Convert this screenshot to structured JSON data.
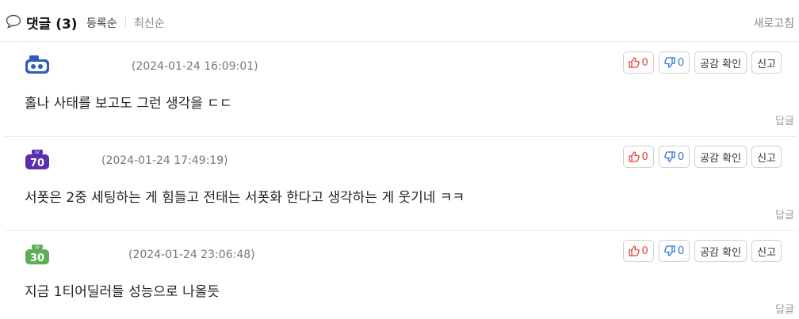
{
  "header": {
    "title": "댓글 (3)",
    "sort_registered": "등록순",
    "sort_latest": "최신순",
    "refresh": "새로고침"
  },
  "comments": [
    {
      "level": "",
      "level_color": "#2f5db8",
      "date": "(2024-01-24 16:09:01)",
      "text": "홀나 사태를 보고도 그런 생각을 ㄷㄷ",
      "likes": "0",
      "dislikes": "0",
      "empathy_label": "공감 확인",
      "report_label": "신고",
      "reply_label": "답글"
    },
    {
      "level": "70",
      "level_color": "#5b2db0",
      "date": "(2024-01-24 17:49:19)",
      "text": "서폿은 2중 세팅하는 게 힘들고 전태는 서폿화 한다고 생각하는 게 웃기네 ㅋㅋ",
      "likes": "0",
      "dislikes": "0",
      "empathy_label": "공감 확인",
      "report_label": "신고",
      "reply_label": "답글"
    },
    {
      "level": "30",
      "level_color": "#5fae55",
      "date": "(2024-01-24 23:06:48)",
      "text": "지금 1티어딜러들 성능으로 나올듯",
      "likes": "0",
      "dislikes": "0",
      "empathy_label": "공감 확인",
      "report_label": "신고",
      "reply_label": "답글"
    }
  ],
  "badge_prefix": "LV",
  "colors": {
    "like": "#e0453a",
    "dislike": "#2f6fd6",
    "divider": "#ececec"
  }
}
